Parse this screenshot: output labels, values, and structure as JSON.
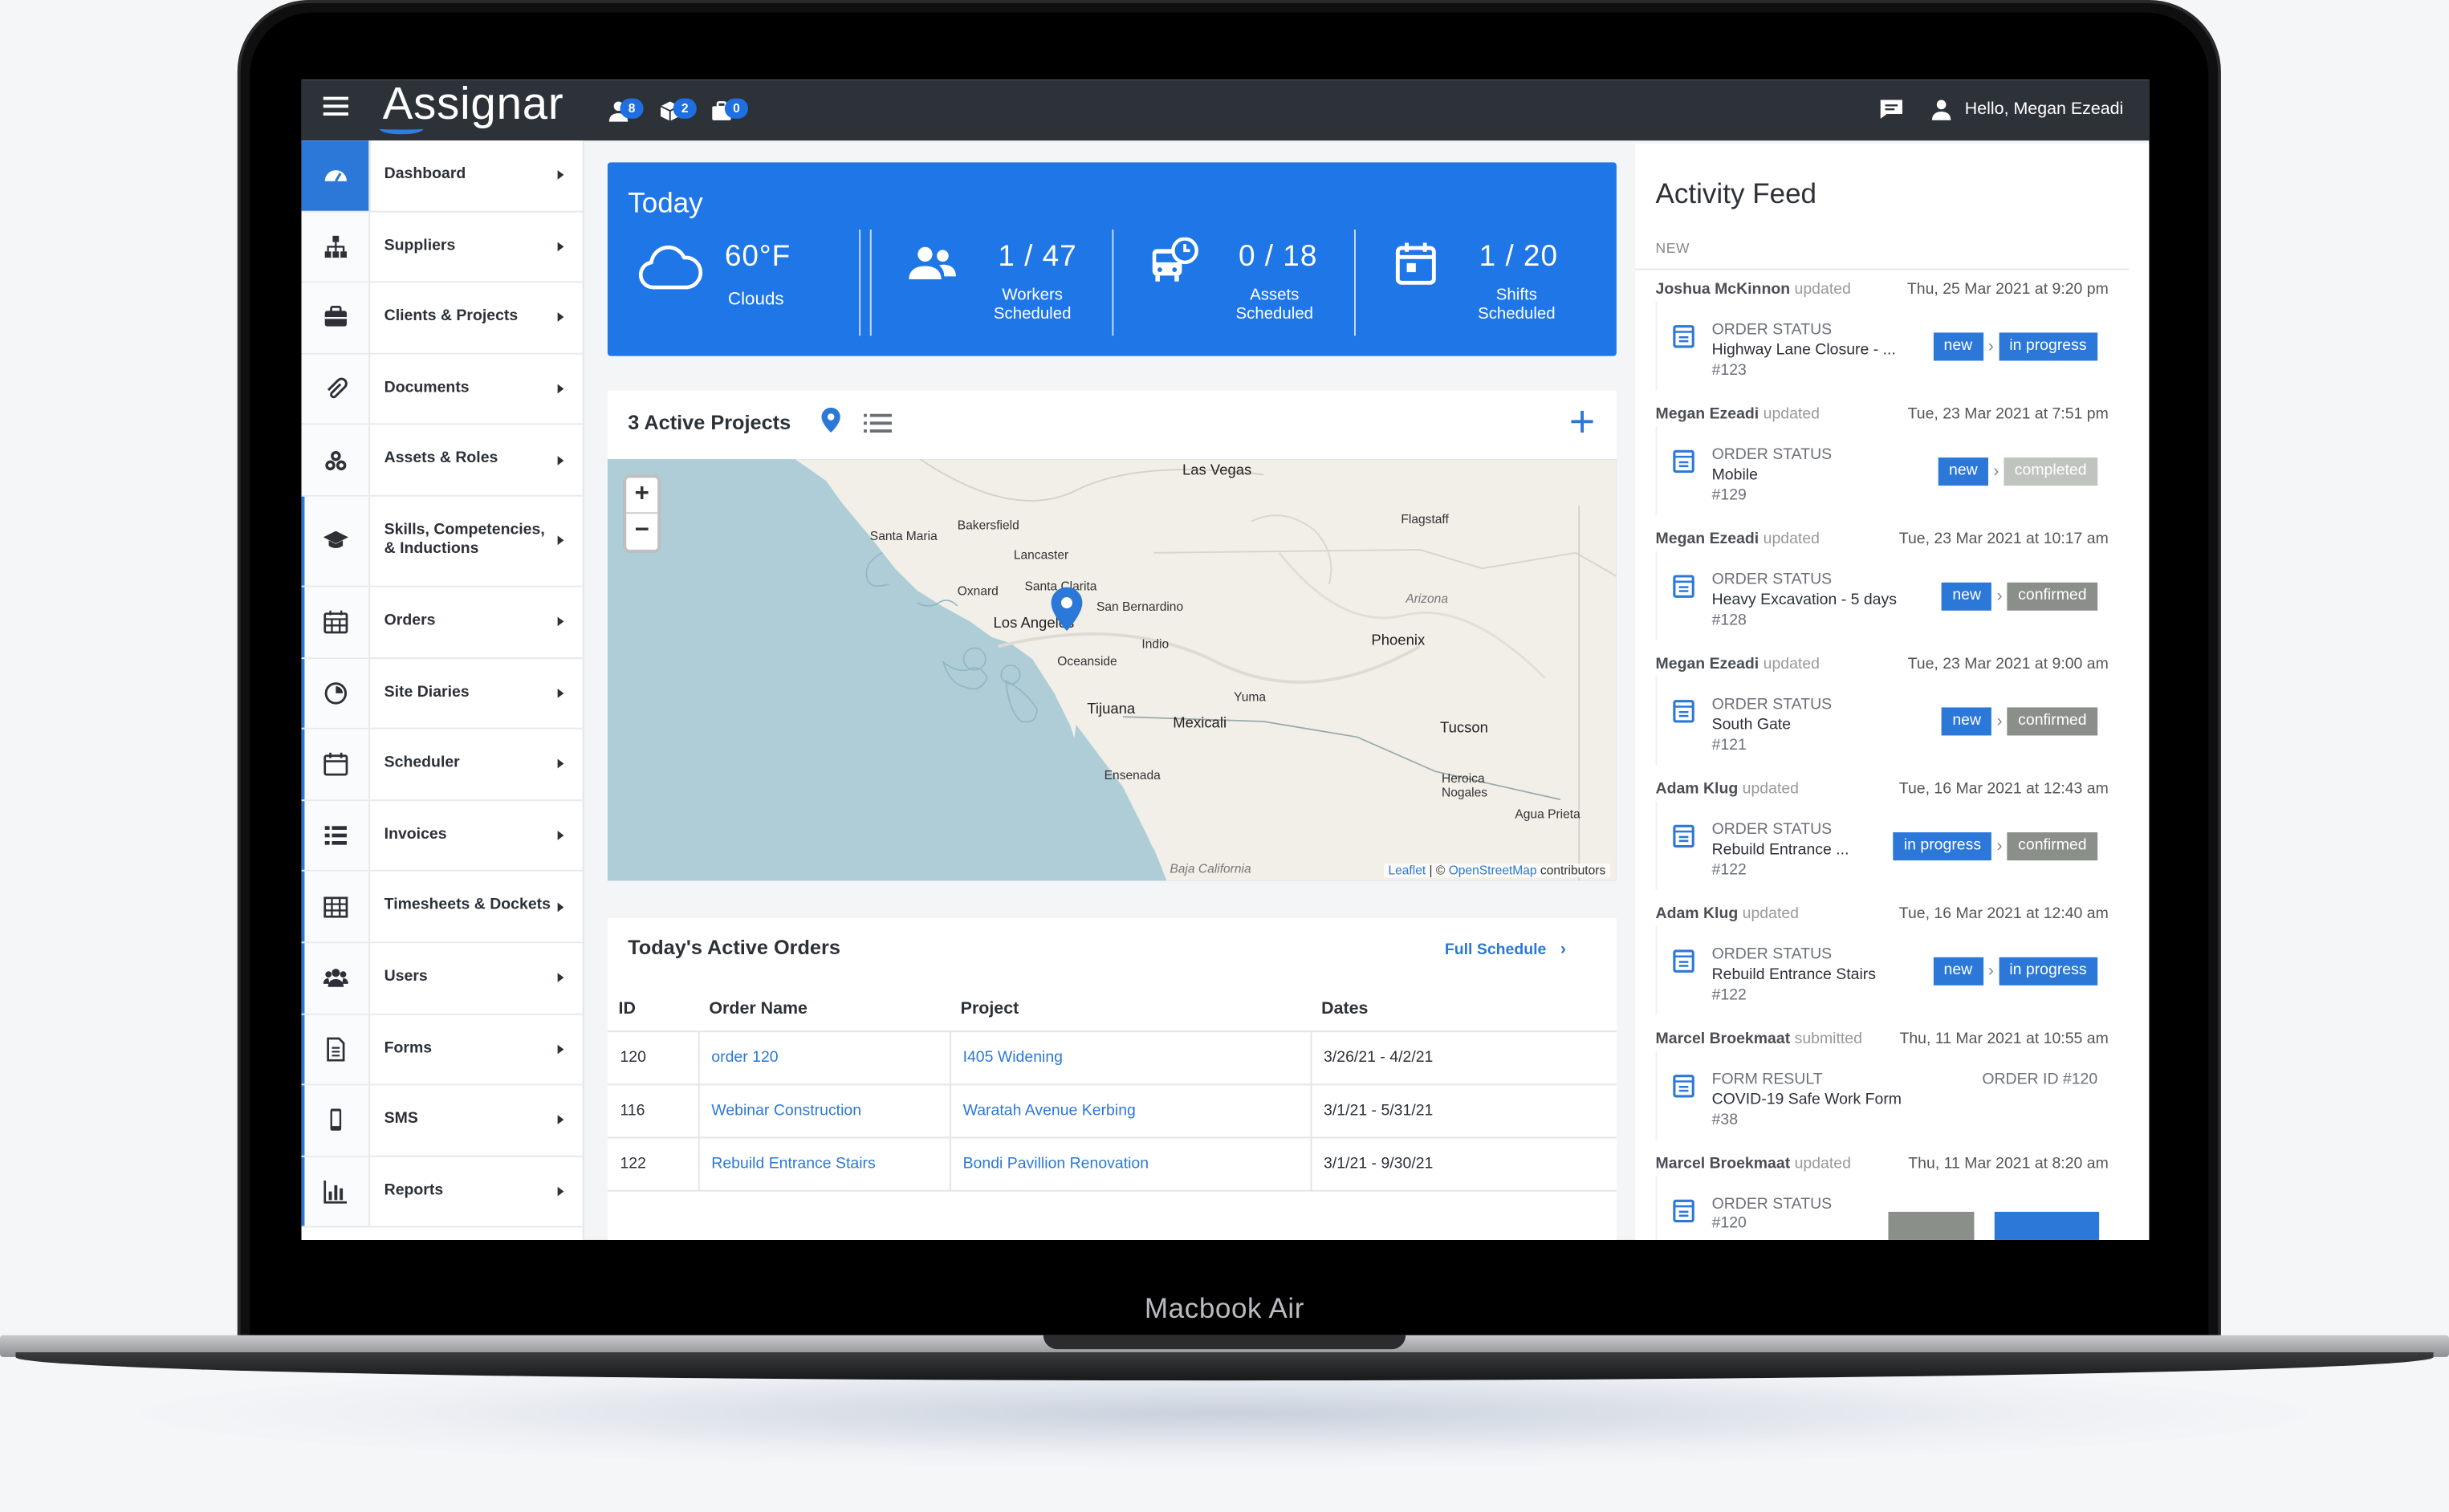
{
  "device": {
    "model_label": "Macbook Air"
  },
  "topbar": {
    "logo": "Assignar",
    "badges": [
      {
        "icon": "user-icon",
        "count": "8"
      },
      {
        "icon": "box-icon",
        "count": "2"
      },
      {
        "icon": "briefcase-icon",
        "count": "0"
      }
    ],
    "greeting": "Hello, Megan Ezeadi"
  },
  "sidebar": {
    "items": [
      {
        "label": "Dashboard",
        "icon": "dashboard-gauge-icon",
        "active": true
      },
      {
        "label": "Suppliers",
        "icon": "org-chart-icon"
      },
      {
        "label": "Clients & Projects",
        "icon": "briefcase-icon"
      },
      {
        "label": "Documents",
        "icon": "paperclip-icon"
      },
      {
        "label": "Assets & Roles",
        "icon": "cubes-icon"
      },
      {
        "label": "Skills, Competencies, & Inductions",
        "icon": "graduation-cap-icon"
      },
      {
        "label": "Orders",
        "icon": "calendar-grid-icon"
      },
      {
        "label": "Site Diaries",
        "icon": "pie-clock-icon"
      },
      {
        "label": "Scheduler",
        "icon": "calendar-icon"
      },
      {
        "label": "Invoices",
        "icon": "list-icon"
      },
      {
        "label": "Timesheets & Dockets",
        "icon": "table-icon"
      },
      {
        "label": "Users",
        "icon": "users-icon"
      },
      {
        "label": "Forms",
        "icon": "file-text-icon"
      },
      {
        "label": "SMS",
        "icon": "mobile-icon"
      },
      {
        "label": "Reports",
        "icon": "bar-chart-icon"
      }
    ]
  },
  "today": {
    "title": "Today",
    "weather": {
      "temp": "60°F",
      "desc": "Clouds"
    },
    "workers": {
      "value": "1 / 47",
      "label_1": "Workers",
      "label_2": "Scheduled"
    },
    "assets": {
      "value": "0 / 18",
      "label_1": "Assets",
      "label_2": "Scheduled"
    },
    "shifts": {
      "value": "1 / 20",
      "label_1": "Shifts",
      "label_2": "Scheduled"
    }
  },
  "projects": {
    "title": "3 Active Projects",
    "map_labels": [
      "Las Vegas",
      "Flagstaff",
      "Bakersfield",
      "Santa Maria",
      "Lancaster",
      "Oxnard",
      "Santa Clarita",
      "San Bernardino",
      "Los Angeles",
      "Arizona",
      "Phoenix",
      "Indio",
      "Oceanside",
      "Yuma",
      "Tijuana",
      "Mexicali",
      "Tucson",
      "Ensenada",
      "Heroica Nogales",
      "Agua Prieta",
      "Baja California"
    ],
    "attribution_link_1": "Leaflet",
    "attribution_sep": " | © ",
    "attribution_link_2": "OpenStreetMap",
    "attribution_tail": " contributors",
    "zoom_in": "+",
    "zoom_out": "−"
  },
  "orders": {
    "title": "Today's Active Orders",
    "full_schedule": "Full Schedule",
    "columns": [
      "ID",
      "Order Name",
      "Project",
      "Dates"
    ],
    "rows": [
      {
        "id": "120",
        "name": "order 120",
        "project": "I405 Widening",
        "dates": "3/26/21 - 4/2/21"
      },
      {
        "id": "116",
        "name": "Webinar Construction",
        "project": "Waratah Avenue Kerbing",
        "dates": "3/1/21 - 5/31/21"
      },
      {
        "id": "122",
        "name": "Rebuild Entrance Stairs",
        "project": "Bondi Pavillion Renovation",
        "dates": "3/1/21 - 9/30/21"
      }
    ]
  },
  "feed": {
    "title": "Activity Feed",
    "section": "NEW",
    "entries": [
      {
        "name": "Joshua McKinnon",
        "verb": "updated",
        "time": "Thu, 25 Mar 2021 at 9:20 pm",
        "type": "ORDER STATUS",
        "desc": "Highway Lane Closure - ...",
        "num": "#123",
        "from": "new",
        "to": "in progress"
      },
      {
        "name": "Megan Ezeadi",
        "verb": "updated",
        "time": "Tue, 23 Mar 2021 at 7:51 pm",
        "type": "ORDER STATUS",
        "desc": "Mobile",
        "num": "#129",
        "from": "new",
        "to": "completed"
      },
      {
        "name": "Megan Ezeadi",
        "verb": "updated",
        "time": "Tue, 23 Mar 2021 at 10:17 am",
        "type": "ORDER STATUS",
        "desc": "Heavy Excavation - 5 days",
        "num": "#128",
        "from": "new",
        "to": "confirmed"
      },
      {
        "name": "Megan Ezeadi",
        "verb": "updated",
        "time": "Tue, 23 Mar 2021 at 9:00 am",
        "type": "ORDER STATUS",
        "desc": "South Gate",
        "num": "#121",
        "from": "new",
        "to": "confirmed"
      },
      {
        "name": "Adam Klug",
        "verb": "updated",
        "time": "Tue, 16 Mar 2021 at 12:43 am",
        "type": "ORDER STATUS",
        "desc": "Rebuild Entrance ...",
        "num": "#122",
        "from": "in progress",
        "to": "confirmed"
      },
      {
        "name": "Adam Klug",
        "verb": "updated",
        "time": "Tue, 16 Mar 2021 at 12:40 am",
        "type": "ORDER STATUS",
        "desc": "Rebuild Entrance Stairs",
        "num": "#122",
        "from": "new",
        "to": "in progress"
      },
      {
        "name": "Marcel Broekmaat",
        "verb": "submitted",
        "time": "Thu, 11 Mar 2021 at 10:55 am",
        "type": "FORM RESULT",
        "desc": "COVID-19 Safe Work Form",
        "num": "#38",
        "order_id": "ORDER ID #120"
      },
      {
        "name": "Marcel Broekmaat",
        "verb": "updated",
        "time": "Thu, 11 Mar 2021 at 8:20 am",
        "type": "ORDER STATUS",
        "desc": "",
        "num": "#120",
        "from": "",
        "to": ""
      }
    ]
  },
  "colors": {
    "accent": "#1f76e6",
    "topbar": "#2d3239",
    "pill_grey": "#8a9089",
    "pill_light_grey": "#bfc4bf"
  }
}
